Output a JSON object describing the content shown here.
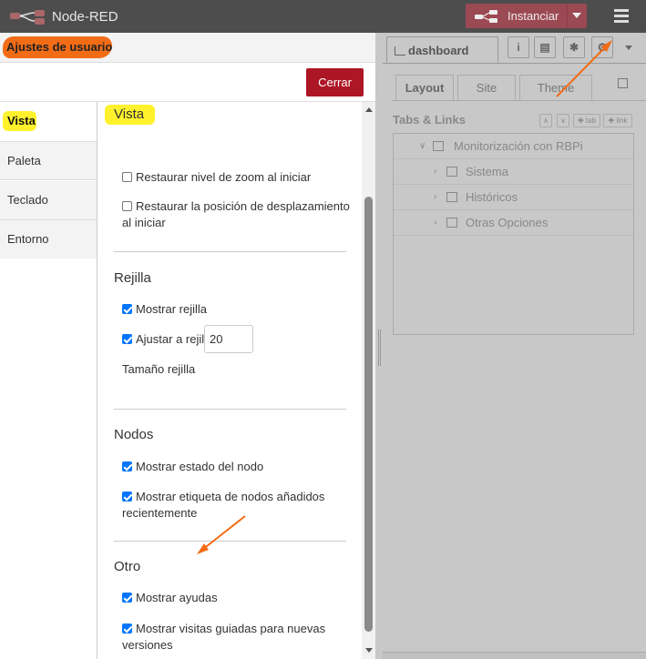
{
  "header": {
    "brand": "Node-RED",
    "deploy_label": "Instanciar",
    "menu_icon": "hamburger-menu-icon"
  },
  "dialog": {
    "title": "Ajustes de usuario",
    "close_label": "Cerrar",
    "tabs": [
      {
        "label": "Vista",
        "active": true
      },
      {
        "label": "Paleta",
        "active": false
      },
      {
        "label": "Teclado",
        "active": false
      },
      {
        "label": "Entorno",
        "active": false
      }
    ],
    "sections": {
      "vista": {
        "title": "Vista",
        "options": [
          {
            "label": "Restaurar nivel de zoom al iniciar",
            "checked": false
          },
          {
            "label": "Restaurar la posición de desplazamiento al iniciar",
            "checked": false
          }
        ]
      },
      "rejilla": {
        "title": "Rejilla",
        "options": [
          {
            "label": "Mostrar rejilla",
            "checked": true
          },
          {
            "label": "Ajustar a rejilla",
            "checked": true
          }
        ],
        "size_label": "Tamaño rejilla",
        "size_value": "20"
      },
      "nodos": {
        "title": "Nodos",
        "options": [
          {
            "label": "Mostrar estado del nodo",
            "checked": true
          },
          {
            "label": "Mostrar etiqueta de nodos añadidos recientemente",
            "checked": true
          }
        ]
      },
      "otro": {
        "title": "Otro",
        "options": [
          {
            "label": "Mostrar ayudas",
            "checked": true
          },
          {
            "label": "Mostrar visitas guiadas para nuevas versiones",
            "checked": true
          }
        ]
      }
    }
  },
  "sidebar": {
    "active_tab": "dashboard",
    "icon_tabs": [
      "info-icon",
      "book-icon",
      "bug-icon",
      "gear-icon"
    ],
    "sub_tabs": [
      {
        "label": "Layout",
        "active": true
      },
      {
        "label": "Site",
        "active": false
      },
      {
        "label": "Theme",
        "active": false
      }
    ],
    "tabs_links_title": "Tabs & Links",
    "mini_buttons": [
      "∧",
      "∨",
      "✚ tab",
      "✚ link"
    ],
    "tree": {
      "root": "Monitorización con RBPi",
      "children": [
        "Sistema",
        "Históricos",
        "Otras Opciones"
      ]
    }
  },
  "colors": {
    "header_bg": "#4d4d4d",
    "deploy_bg": "#9b4953",
    "close_bg": "#ad1625",
    "highlight_orange": "#f26c16",
    "highlight_yellow": "#fff22d",
    "arrow": "#f26c16",
    "checkbox_on": "#0075ff"
  }
}
